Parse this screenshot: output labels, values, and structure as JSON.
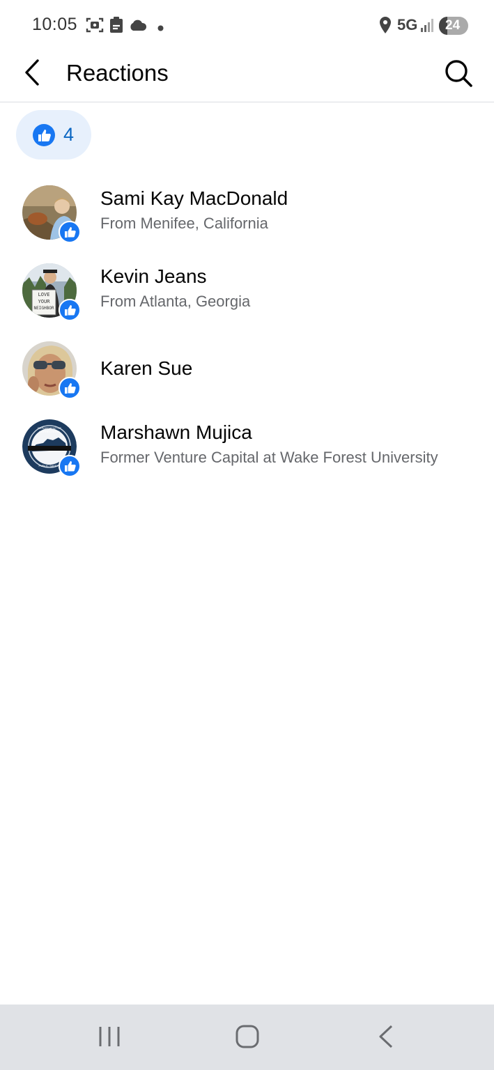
{
  "status_bar": {
    "time": "10:05",
    "network": "5G",
    "battery": "24",
    "left_icons": [
      "screenshot-icon",
      "clipboard-icon",
      "cloud-icon",
      "notification-dot-icon"
    ],
    "right_icons": [
      "location-icon",
      "signal-icon",
      "battery-icon"
    ]
  },
  "header": {
    "title": "Reactions",
    "back_icon": "chevron-left-icon",
    "search_icon": "search-icon"
  },
  "reaction_filter": {
    "type": "like",
    "count": "4",
    "accent": "#1877f2",
    "count_color": "#0a66c2",
    "background": "#e7f0fc"
  },
  "people": [
    {
      "name": "Sami Kay MacDonald",
      "subtitle": "From Menifee, California",
      "reaction": "like"
    },
    {
      "name": "Kevin Jeans",
      "subtitle": "From Atlanta, Georgia",
      "reaction": "like",
      "avatar_sign": [
        "LOVE",
        "YOUR",
        "NEIGHBOR"
      ]
    },
    {
      "name": "Karen Sue",
      "subtitle": "",
      "reaction": "like"
    },
    {
      "name": "Marshawn Mujica",
      "subtitle": "Former Venture Capital at Wake Forest University",
      "reaction": "like",
      "avatar_seal": [
        "DEPARTMENT OF CORRECTIONS",
        "PUBLIC SAFETY"
      ]
    }
  ],
  "nav_bar": {
    "icons": [
      "recent-apps-icon",
      "home-icon",
      "back-icon"
    ]
  }
}
